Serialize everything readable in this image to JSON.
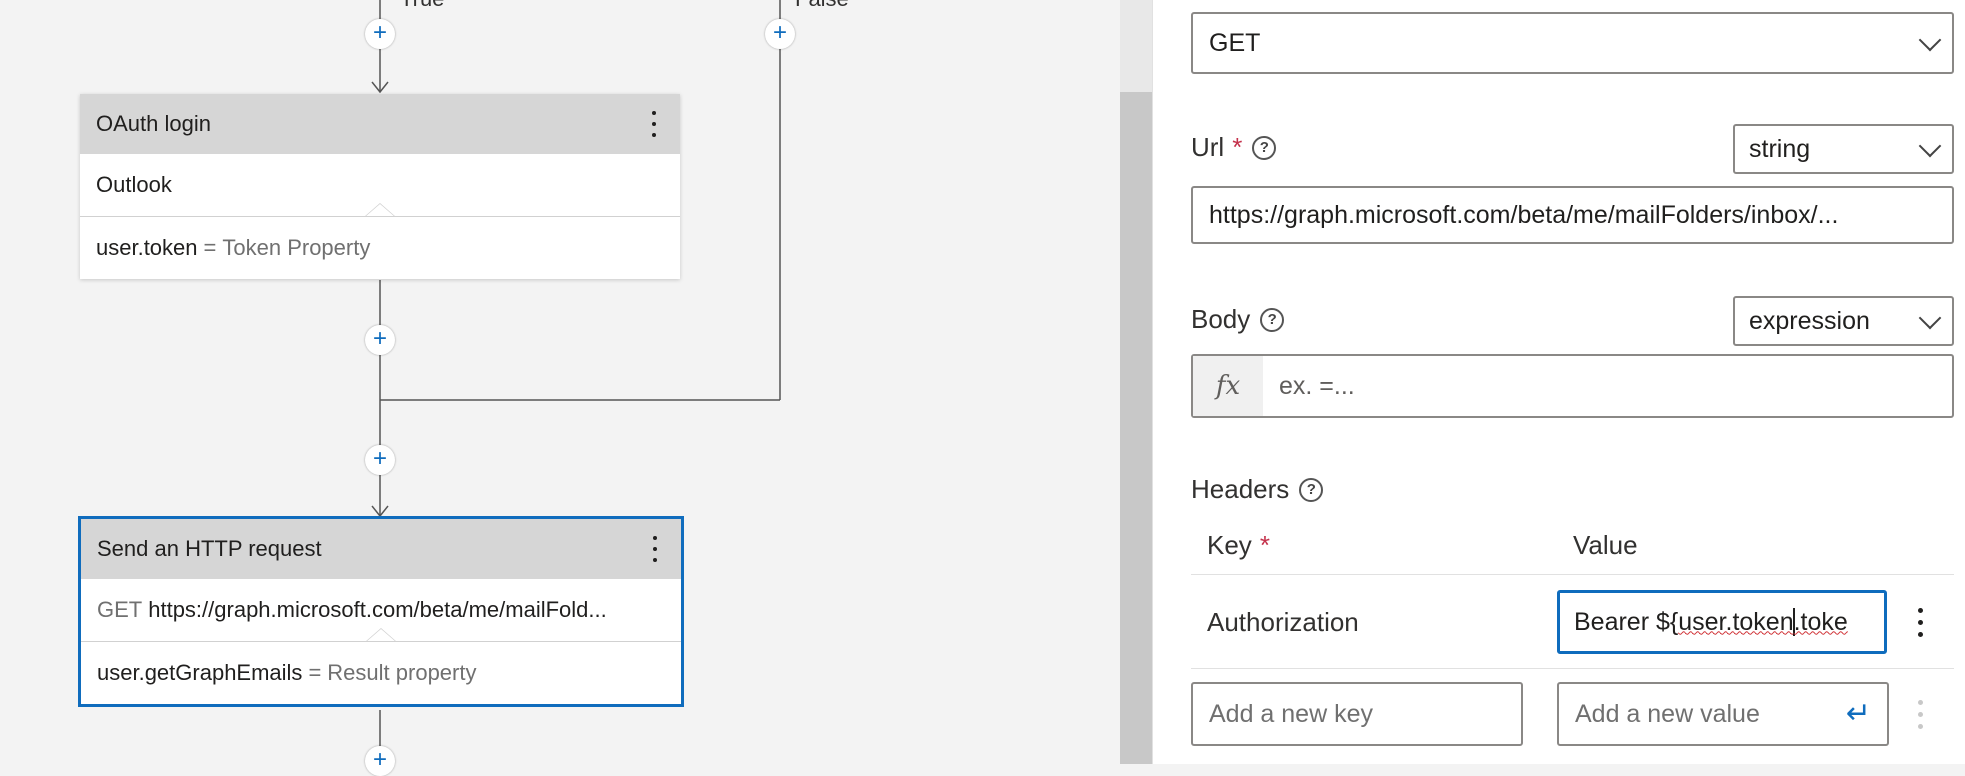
{
  "canvas": {
    "branches": {
      "true_label": "True",
      "false_label": "False"
    },
    "oauth_node": {
      "title": "OAuth login",
      "connection": "Outlook",
      "output_var": "user.token",
      "output_eq": "=",
      "output_prop": "Token Property"
    },
    "http_node": {
      "title": "Send an HTTP request",
      "method": "GET",
      "url": "https://graph.microsoft.com/beta/me/mailFold...",
      "output_var": "user.getGraphEmails",
      "output_eq": "=",
      "output_prop": "Result property"
    },
    "plus_symbol": "+"
  },
  "panel": {
    "method": {
      "value": "GET"
    },
    "url": {
      "label": "Url",
      "required_mark": "*",
      "type_value": "string",
      "value": "https://graph.microsoft.com/beta/me/mailFolders/inbox/..."
    },
    "body": {
      "label": "Body",
      "type_value": "expression",
      "fx_label": "fx",
      "placeholder": "ex. =..."
    },
    "headers": {
      "label": "Headers",
      "col_key": "Key",
      "col_key_required": "*",
      "col_value": "Value",
      "rows": [
        {
          "key": "Authorization",
          "value_prefix": "Bearer ${",
          "value_part1": "user.token",
          "value_part2": ".toke"
        }
      ],
      "new_key_placeholder": "Add a new key",
      "new_value_placeholder": "Add a new value",
      "enter_icon": "↵"
    },
    "help_symbol": "?"
  },
  "colors": {
    "accent": "#0f6cbd",
    "required": "#c4314b",
    "node_header": "#d6d6d6"
  }
}
